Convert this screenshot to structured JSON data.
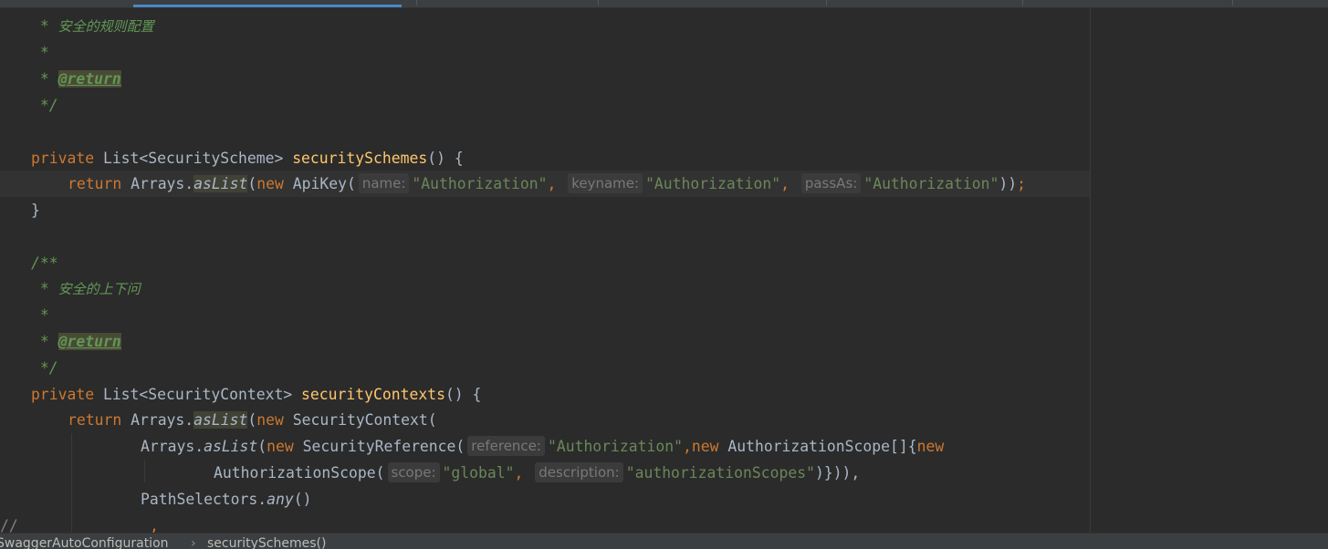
{
  "editor": {
    "lines": [
      {
        "comment_line_1": " * ",
        "comment_text": "安全的规则配置"
      },
      {
        "star": " *"
      },
      {
        "star_prefix": " * ",
        "return_tag": "@return"
      },
      {
        "comment_end": " */"
      },
      {
        "private": "private",
        "return_type": " List<SecurityScheme> ",
        "method": "securitySchemes",
        "tail": "() {"
      },
      {
        "return_kw": "return",
        "arrays": " Arrays.",
        "aslist": "asList",
        "open": "(",
        "new_kw": "new",
        "ctor": " ApiKey(",
        "hint_name": "name:",
        "str1": "\"Authorization\"",
        "comma1": ", ",
        "hint_keyname": "keyname:",
        "str2": "\"Authorization\"",
        "comma2": ", ",
        "hint_passas": "passAs:",
        "str3": "\"Authorization\"",
        "close": "))",
        "semi": ";"
      },
      {
        "brace": "}"
      },
      {
        "javadoc_start": "/**"
      },
      {
        "star_prefix": " * ",
        "comment_text": "安全的上下问"
      },
      {
        "star": " *"
      },
      {
        "star_prefix": " * ",
        "return_tag": "@return"
      },
      {
        "comment_end": " */"
      },
      {
        "private": "private",
        "return_type": " List<SecurityContext> ",
        "method": "securityContexts",
        "tail": "() {"
      },
      {
        "return_kw": "return",
        "arrays": " Arrays.",
        "aslist": "asList",
        "open": "(",
        "new_kw": "new",
        "ctor": " SecurityContext("
      },
      {
        "arrays": "Arrays.",
        "aslist": "asList",
        "open": "(",
        "new_kw": "new",
        "ctor": " SecurityReference(",
        "hint_reference": "reference:",
        "str1": "\"Authorization\"",
        "comma": ",",
        "new_kw2": "new",
        "ctor2": " AuthorizationScope[]{",
        "new_kw3": "new"
      },
      {
        "ctor": "AuthorizationScope(",
        "hint_scope": "scope:",
        "str1": "\"global\"",
        "comma1": ", ",
        "hint_description": "description:",
        "str2": "\"authorizationScopes\"",
        "close": ")})),"
      },
      {
        "selectors": "PathSelectors.",
        "any": "any",
        "parens": "()"
      },
      {
        "partial": ","
      }
    ],
    "fragment_left": "//"
  },
  "breadcrumb": {
    "class_name": "SwaggerAutoConfiguration",
    "separator": "›",
    "method_name": "securitySchemes()"
  }
}
